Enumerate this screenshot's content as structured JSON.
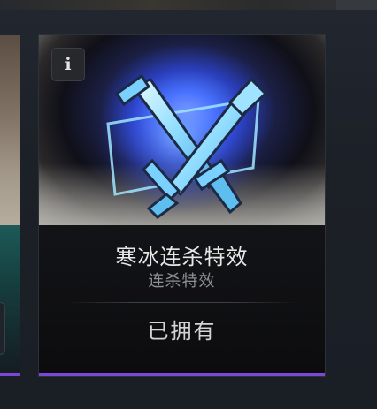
{
  "cards": [
    {
      "title": "寒冰连杀特效",
      "category": "连杀特效",
      "status": "已拥有",
      "info_icon": "i",
      "thumbnail_icon": "crossed-swords-icon",
      "rarity_color": "#7b47d9"
    }
  ],
  "colors": {
    "background": "#1b1f26",
    "card_background": "#121316",
    "title_text": "#e7e7e7",
    "subtitle_text": "#8e8f93"
  }
}
